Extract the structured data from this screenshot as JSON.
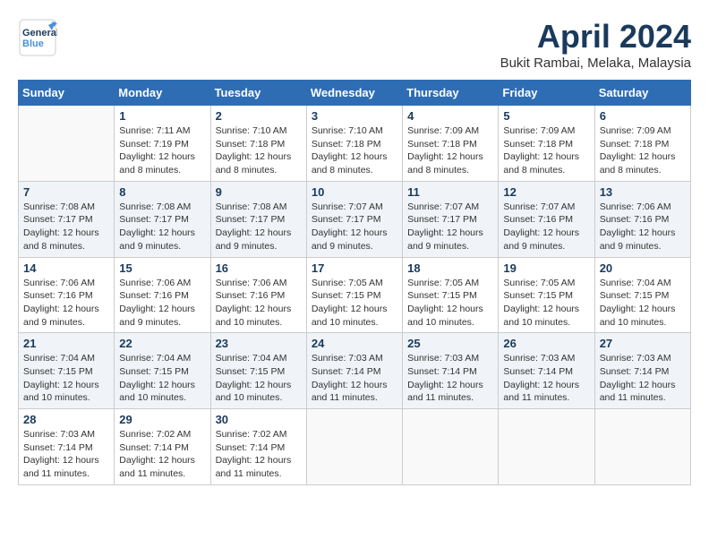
{
  "header": {
    "logo_general": "General",
    "logo_blue": "Blue",
    "month_title": "April 2024",
    "location": "Bukit Rambai, Melaka, Malaysia"
  },
  "days_of_week": [
    "Sunday",
    "Monday",
    "Tuesday",
    "Wednesday",
    "Thursday",
    "Friday",
    "Saturday"
  ],
  "weeks": [
    [
      {
        "day": "",
        "info": ""
      },
      {
        "day": "1",
        "info": "Sunrise: 7:11 AM\nSunset: 7:19 PM\nDaylight: 12 hours and 8 minutes."
      },
      {
        "day": "2",
        "info": "Sunrise: 7:10 AM\nSunset: 7:18 PM\nDaylight: 12 hours and 8 minutes."
      },
      {
        "day": "3",
        "info": "Sunrise: 7:10 AM\nSunset: 7:18 PM\nDaylight: 12 hours and 8 minutes."
      },
      {
        "day": "4",
        "info": "Sunrise: 7:09 AM\nSunset: 7:18 PM\nDaylight: 12 hours and 8 minutes."
      },
      {
        "day": "5",
        "info": "Sunrise: 7:09 AM\nSunset: 7:18 PM\nDaylight: 12 hours and 8 minutes."
      },
      {
        "day": "6",
        "info": "Sunrise: 7:09 AM\nSunset: 7:18 PM\nDaylight: 12 hours and 8 minutes."
      }
    ],
    [
      {
        "day": "7",
        "info": "Sunrise: 7:08 AM\nSunset: 7:17 PM\nDaylight: 12 hours and 8 minutes."
      },
      {
        "day": "8",
        "info": "Sunrise: 7:08 AM\nSunset: 7:17 PM\nDaylight: 12 hours and 9 minutes."
      },
      {
        "day": "9",
        "info": "Sunrise: 7:08 AM\nSunset: 7:17 PM\nDaylight: 12 hours and 9 minutes."
      },
      {
        "day": "10",
        "info": "Sunrise: 7:07 AM\nSunset: 7:17 PM\nDaylight: 12 hours and 9 minutes."
      },
      {
        "day": "11",
        "info": "Sunrise: 7:07 AM\nSunset: 7:17 PM\nDaylight: 12 hours and 9 minutes."
      },
      {
        "day": "12",
        "info": "Sunrise: 7:07 AM\nSunset: 7:16 PM\nDaylight: 12 hours and 9 minutes."
      },
      {
        "day": "13",
        "info": "Sunrise: 7:06 AM\nSunset: 7:16 PM\nDaylight: 12 hours and 9 minutes."
      }
    ],
    [
      {
        "day": "14",
        "info": "Sunrise: 7:06 AM\nSunset: 7:16 PM\nDaylight: 12 hours and 9 minutes."
      },
      {
        "day": "15",
        "info": "Sunrise: 7:06 AM\nSunset: 7:16 PM\nDaylight: 12 hours and 9 minutes."
      },
      {
        "day": "16",
        "info": "Sunrise: 7:06 AM\nSunset: 7:16 PM\nDaylight: 12 hours and 10 minutes."
      },
      {
        "day": "17",
        "info": "Sunrise: 7:05 AM\nSunset: 7:15 PM\nDaylight: 12 hours and 10 minutes."
      },
      {
        "day": "18",
        "info": "Sunrise: 7:05 AM\nSunset: 7:15 PM\nDaylight: 12 hours and 10 minutes."
      },
      {
        "day": "19",
        "info": "Sunrise: 7:05 AM\nSunset: 7:15 PM\nDaylight: 12 hours and 10 minutes."
      },
      {
        "day": "20",
        "info": "Sunrise: 7:04 AM\nSunset: 7:15 PM\nDaylight: 12 hours and 10 minutes."
      }
    ],
    [
      {
        "day": "21",
        "info": "Sunrise: 7:04 AM\nSunset: 7:15 PM\nDaylight: 12 hours and 10 minutes."
      },
      {
        "day": "22",
        "info": "Sunrise: 7:04 AM\nSunset: 7:15 PM\nDaylight: 12 hours and 10 minutes."
      },
      {
        "day": "23",
        "info": "Sunrise: 7:04 AM\nSunset: 7:15 PM\nDaylight: 12 hours and 10 minutes."
      },
      {
        "day": "24",
        "info": "Sunrise: 7:03 AM\nSunset: 7:14 PM\nDaylight: 12 hours and 11 minutes."
      },
      {
        "day": "25",
        "info": "Sunrise: 7:03 AM\nSunset: 7:14 PM\nDaylight: 12 hours and 11 minutes."
      },
      {
        "day": "26",
        "info": "Sunrise: 7:03 AM\nSunset: 7:14 PM\nDaylight: 12 hours and 11 minutes."
      },
      {
        "day": "27",
        "info": "Sunrise: 7:03 AM\nSunset: 7:14 PM\nDaylight: 12 hours and 11 minutes."
      }
    ],
    [
      {
        "day": "28",
        "info": "Sunrise: 7:03 AM\nSunset: 7:14 PM\nDaylight: 12 hours and 11 minutes."
      },
      {
        "day": "29",
        "info": "Sunrise: 7:02 AM\nSunset: 7:14 PM\nDaylight: 12 hours and 11 minutes."
      },
      {
        "day": "30",
        "info": "Sunrise: 7:02 AM\nSunset: 7:14 PM\nDaylight: 12 hours and 11 minutes."
      },
      {
        "day": "",
        "info": ""
      },
      {
        "day": "",
        "info": ""
      },
      {
        "day": "",
        "info": ""
      },
      {
        "day": "",
        "info": ""
      }
    ]
  ]
}
